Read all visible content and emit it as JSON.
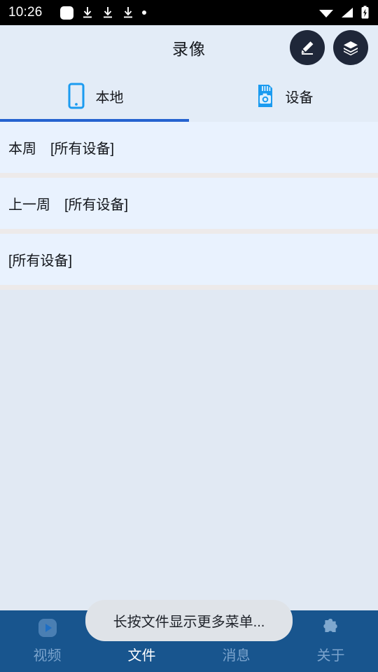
{
  "statusbar": {
    "time": "10:26",
    "left_icons": [
      "app-badge-icon",
      "download-icon",
      "download-icon",
      "download-icon",
      "dot-icon"
    ],
    "right_icons": [
      "wifi-icon",
      "signal-icon",
      "battery-charging-icon"
    ]
  },
  "appbar": {
    "title": "录像",
    "actions": [
      {
        "name": "edit-button",
        "icon": "pencil-icon"
      },
      {
        "name": "layers-button",
        "icon": "layers-icon"
      }
    ]
  },
  "tabs": {
    "items": [
      {
        "label": "本地",
        "icon": "phone-icon",
        "active": true
      },
      {
        "label": "设备",
        "icon": "sdcard-camera-icon",
        "active": false
      }
    ],
    "active_color": "#2563d0"
  },
  "list": {
    "rows": [
      {
        "label": "本周　[所有设备]"
      },
      {
        "label": "上一周　[所有设备]"
      },
      {
        "label": "[所有设备]"
      }
    ]
  },
  "toast": {
    "message": "长按文件显示更多菜单..."
  },
  "bottomnav": {
    "items": [
      {
        "label": "视频",
        "icon": "play-video-icon",
        "active": false
      },
      {
        "label": "文件",
        "icon": "folder-file-icon",
        "active": true
      },
      {
        "label": "消息",
        "icon": "message-icon",
        "active": false
      },
      {
        "label": "关于",
        "icon": "puzzle-piece-icon",
        "active": false
      }
    ],
    "bar_color": "#18558e",
    "active_color": "#ffffff",
    "inactive_color": "#7ba4cd"
  }
}
